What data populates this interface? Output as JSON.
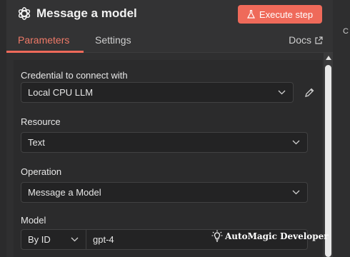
{
  "header": {
    "title": "Message a model",
    "execute_label": "Execute step",
    "accent_color": "#ef6a5a"
  },
  "tabs": [
    {
      "label": "Parameters",
      "active": true
    },
    {
      "label": "Settings",
      "active": false
    }
  ],
  "docs_label": "Docs",
  "fields": {
    "credential": {
      "label": "Credential to connect with",
      "value": "Local CPU LLM"
    },
    "resource": {
      "label": "Resource",
      "value": "Text"
    },
    "operation": {
      "label": "Operation",
      "value": "Message a Model"
    },
    "model": {
      "label": "Model",
      "mode": "By ID",
      "value": "gpt-4"
    }
  },
  "watermark": "AutoMagic Developer",
  "icons": {
    "logo": "openai-logo-icon",
    "execute": "flask-icon",
    "docs": "external-link-icon",
    "edit": "pencil-icon",
    "dropdown": "chevron-down-icon"
  }
}
